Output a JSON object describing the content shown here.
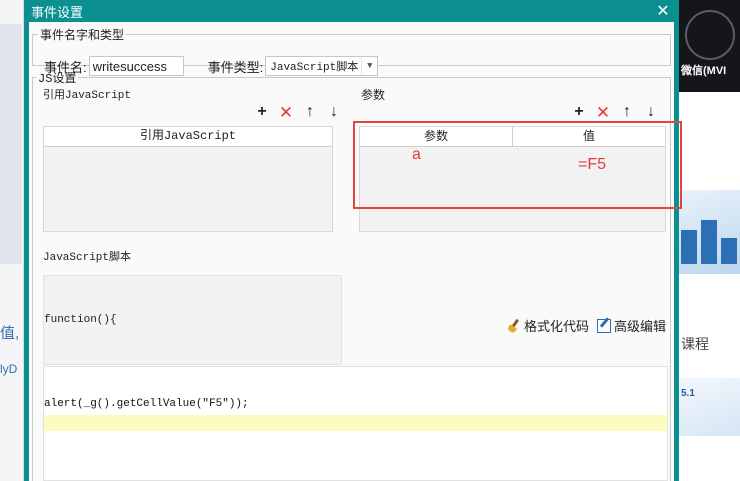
{
  "dialog": {
    "title": "事件设置",
    "close_symbol": "✕"
  },
  "name_section": {
    "legend": "事件名字和类型",
    "event_name_label": "事件名:",
    "event_name_value": "writesuccess",
    "event_type_label": "事件类型:",
    "event_type_value": "JavaScript脚本"
  },
  "js_section": {
    "legend": "JS设置",
    "ref_js": {
      "title": "引用JavaScript",
      "column": "引用JavaScript"
    },
    "params": {
      "title": "参数",
      "col_param": "参数",
      "col_value": "值",
      "row_param": "a",
      "row_value": "=F5"
    },
    "toolbar": {
      "add": "+",
      "delete": "✕",
      "up": "↑",
      "down": "↓"
    },
    "script": {
      "title": "JavaScript脚本",
      "header_code": "function(){",
      "format_label": "格式化代码",
      "advanced_label": "高级编辑",
      "body_code": "alert(_g().getCellValue(\"F5\"));"
    }
  },
  "background": {
    "banner_text": "微信(MVI",
    "right_label": "课程",
    "small_banner_text": "5.1",
    "left_text_1": "值,",
    "left_text_2": "lyD"
  },
  "colors": {
    "titlebar": "#0b8f8f",
    "accent_red": "#e23b3b",
    "active_line": "#fbfbbf"
  }
}
